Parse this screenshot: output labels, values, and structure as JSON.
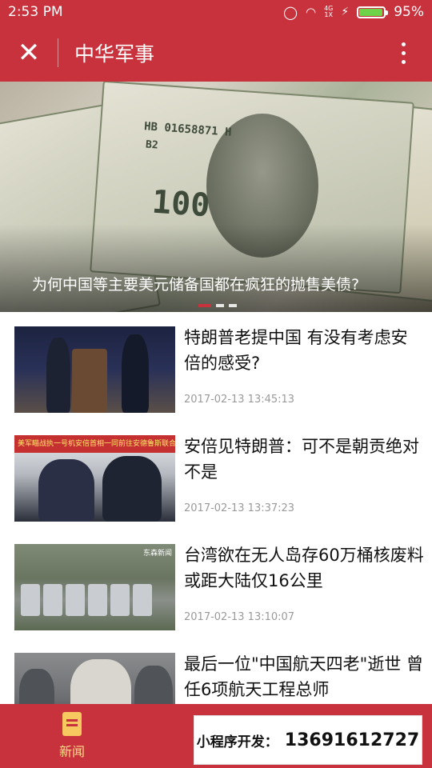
{
  "status_bar": {
    "time": "2:53 PM",
    "network_top": "4G",
    "network_bottom": "1X",
    "battery": "95%"
  },
  "app_bar": {
    "title": "中华军事"
  },
  "banner": {
    "caption": "为何中国等主要美元储备国都在疯狂的抛售美债?",
    "note_serial": "HB 01658871 H",
    "note_code": "B2",
    "note_value": "100",
    "active_dot": 0,
    "dot_count": 3
  },
  "articles": [
    {
      "title": "特朗普老提中国 有没有考虑安倍的感受?",
      "time": "2017-02-13 13:45:13"
    },
    {
      "title": "安倍见特朗普：可不是朝贡绝对不是",
      "time": "2017-02-13 13:37:23",
      "thumb_caption": "美军瞄战执一号机安倍首相一同前往安德鲁斯联合基地"
    },
    {
      "title": "台湾欲在无人岛存60万桶核废料 或距大陆仅16公里",
      "time": "2017-02-13 13:10:07",
      "thumb_caption": "东森新闻"
    },
    {
      "title": "最后一位\"中国航天四老\"逝世 曾任6项航天工程总师",
      "time": ""
    }
  ],
  "tab_bar": {
    "news_label": "新闻"
  },
  "promo": {
    "label": "小程序开发：",
    "phone": "13691612727"
  }
}
